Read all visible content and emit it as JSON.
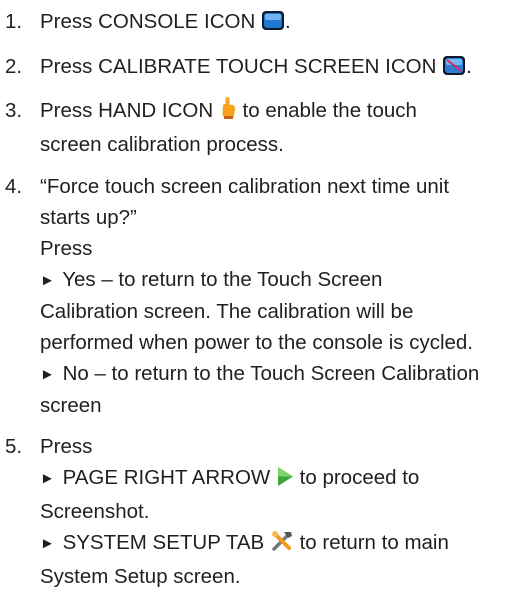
{
  "steps": [
    {
      "num": "1.",
      "text_before": "Press CONSOLE ICON",
      "icon": "console-icon",
      "text_after": "."
    },
    {
      "num": "2.",
      "text_before": "Press CALIBRATE TOUCH SCREEN ICON",
      "icon": "calibrate-touch-screen-icon",
      "text_after": "."
    },
    {
      "num": "3.",
      "text_before": "Press HAND ICON",
      "icon": "hand-icon",
      "text_after": "to enable the touch",
      "line2": "screen calibration process."
    },
    {
      "num": "4.",
      "lines": [
        "“Force touch screen calibration next time unit",
        "starts up?”",
        "Press"
      ],
      "options": [
        {
          "marker": "►",
          "lines": [
            "Yes – to return to the Touch Screen",
            "Calibration screen. The calibration will be",
            "performed when power to the console is cycled."
          ]
        },
        {
          "marker": "►",
          "lines": [
            "No – to return to the Touch Screen Calibration",
            "screen"
          ]
        }
      ]
    },
    {
      "num": "5.",
      "lines": [
        "Press"
      ],
      "options": [
        {
          "marker": "►",
          "text_before": "PAGE RIGHT ARROW",
          "icon": "page-right-arrow-icon",
          "text_after": "to proceed to",
          "line2": "Screenshot."
        },
        {
          "marker": "►",
          "text_before": "SYSTEM SETUP TAB",
          "icon": "system-setup-tab-icon",
          "text_after": "to return to main",
          "line2": "System Setup screen."
        }
      ]
    }
  ],
  "colors": {
    "text": "#231f20",
    "console_blue": "#1e78d0",
    "hand_orange": "#f5a623",
    "arrow_green": "#3aa63a",
    "tools_orange": "#f29a1e"
  }
}
